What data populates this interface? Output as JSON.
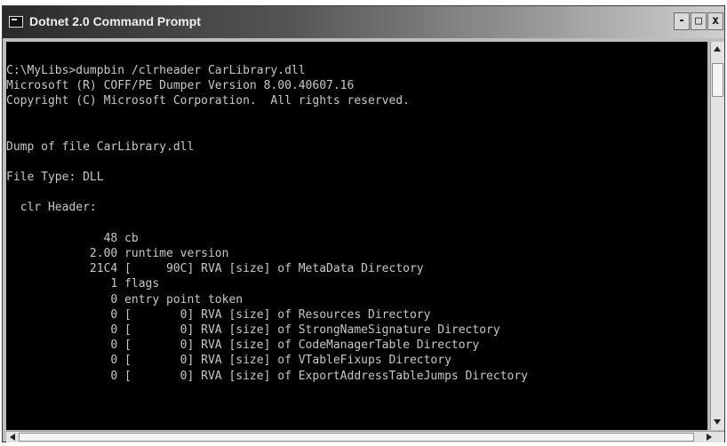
{
  "window": {
    "title": "Dotnet 2.0 Command Prompt",
    "buttons": {
      "minimize": "-",
      "maximize": "□",
      "close": "x"
    }
  },
  "console": {
    "lines": [
      "C:\\MyLibs>dumpbin /clrheader CarLibrary.dll",
      "Microsoft (R) COFF/PE Dumper Version 8.00.40607.16",
      "Copyright (C) Microsoft Corporation.  All rights reserved.",
      "",
      "",
      "Dump of file CarLibrary.dll",
      "",
      "File Type: DLL",
      "",
      "  clr Header:",
      "",
      "              48 cb",
      "            2.00 runtime version",
      "            21C4 [     90C] RVA [size] of MetaData Directory",
      "               1 flags",
      "               0 entry point token",
      "               0 [       0] RVA [size] of Resources Directory",
      "               0 [       0] RVA [size] of StrongNameSignature Directory",
      "               0 [       0] RVA [size] of CodeManagerTable Directory",
      "               0 [       0] RVA [size] of VTableFixups Directory",
      "               0 [       0] RVA [size] of ExportAddressTableJumps Directory"
    ]
  },
  "colors": {
    "console_background": "#000000",
    "console_text": "#c8c8c8",
    "title_text": "#eeeeee"
  }
}
